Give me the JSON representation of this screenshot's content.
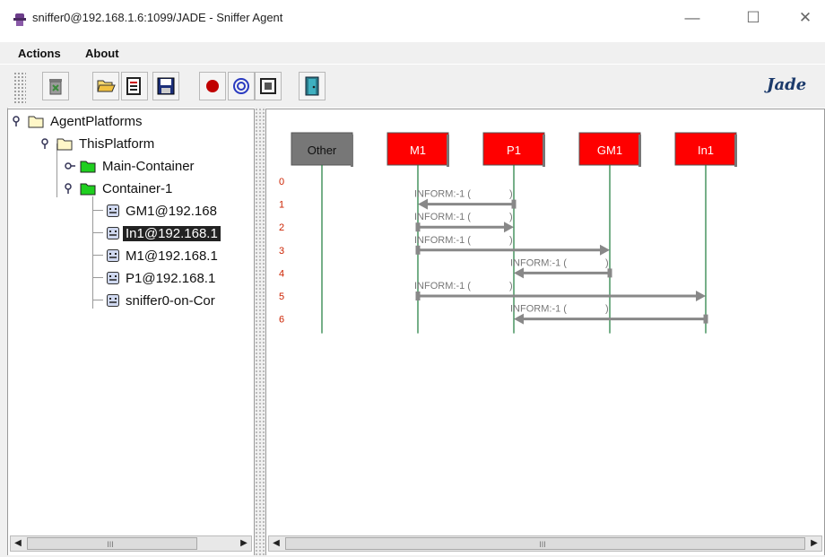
{
  "window": {
    "title": "sniffer0@192.168.1.6:1099/JADE - Sniffer Agent",
    "minimize_glyph": "—",
    "maximize_glyph": "☐",
    "close_glyph": "✕"
  },
  "menu": [
    {
      "label": "Actions"
    },
    {
      "label": "About"
    }
  ],
  "toolbar": {
    "buttons": [
      {
        "icon": "trash-icon"
      },
      {
        "icon": "open-folder-icon"
      },
      {
        "icon": "document-icon"
      },
      {
        "icon": "save-icon"
      },
      {
        "icon": "record-icon"
      },
      {
        "icon": "swirl-icon"
      },
      {
        "icon": "frame-icon"
      },
      {
        "icon": "exit-door-icon"
      }
    ],
    "logo_text": "Jade"
  },
  "tree": {
    "nodes": [
      {
        "label": "AgentPlatforms",
        "type": "folder-open"
      },
      {
        "label": "ThisPlatform",
        "type": "folder-open"
      },
      {
        "label": "Main-Container",
        "type": "container"
      },
      {
        "label": "Container-1",
        "type": "container"
      },
      {
        "label": "GM1@192.168",
        "type": "agent"
      },
      {
        "label": "In1@192.168.1",
        "type": "agent",
        "selected": true
      },
      {
        "label": "M1@192.168.1",
        "type": "agent"
      },
      {
        "label": "P1@192.168.1",
        "type": "agent"
      },
      {
        "label": "sniffer0-on-Cor",
        "type": "agent"
      }
    ]
  },
  "sniffer": {
    "agents": [
      {
        "name": "Other",
        "color": "#777777"
      },
      {
        "name": "M1",
        "color": "#ff0000"
      },
      {
        "name": "P1",
        "color": "#ff0000"
      },
      {
        "name": "GM1",
        "color": "#ff0000"
      },
      {
        "name": "In1",
        "color": "#ff0000"
      }
    ],
    "rows": [
      "0",
      "1",
      "2",
      "3",
      "4",
      "5",
      "6"
    ],
    "messages": [
      {
        "row": 1,
        "from": "P1",
        "to": "M1",
        "label": "INFORM:-1 (",
        "paren": ")"
      },
      {
        "row": 2,
        "from": "M1",
        "to": "P1",
        "label": "INFORM:-1 (",
        "paren": ")"
      },
      {
        "row": 3,
        "from": "M1",
        "to": "GM1",
        "label": "INFORM:-1 (",
        "paren": ")"
      },
      {
        "row": 4,
        "from": "GM1",
        "to": "P1",
        "label": "INFORM:-1 (",
        "paren": ")"
      },
      {
        "row": 5,
        "from": "M1",
        "to": "In1",
        "label": "INFORM:-1 (",
        "paren": ")"
      },
      {
        "row": 6,
        "from": "In1",
        "to": "P1",
        "label": "INFORM:-1 (",
        "paren": ")"
      }
    ]
  },
  "scroll": {
    "left_arrow": "◀",
    "right_arrow": "▶",
    "thumb_grip": "III"
  }
}
